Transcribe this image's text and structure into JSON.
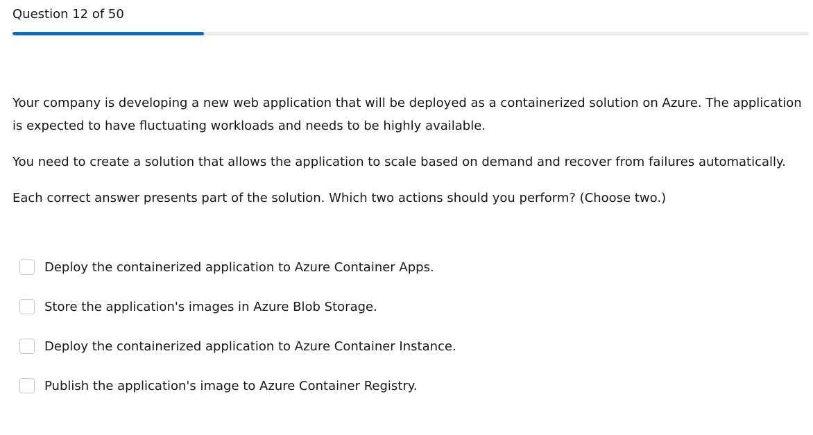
{
  "header": {
    "question_counter": "Question 12 of 50"
  },
  "progress": {
    "current": 12,
    "total": 50,
    "fraction": 0.24,
    "fill_color": "#0f6cbd",
    "track_color": "#ebebeb"
  },
  "question": {
    "paragraphs": [
      "Your company is developing a new web application that will be deployed as a containerized solution on Azure. The application is expected to have fluctuating workloads and needs to be highly available.",
      "You need to create a solution that allows the application to scale based on demand and recover from failures automatically.",
      "Each correct answer presents part of the solution. Which two actions should you perform? (Choose two.)"
    ]
  },
  "options": [
    {
      "label": "Deploy the containerized application to Azure Container Apps.",
      "checked": false
    },
    {
      "label": "Store the application's images in Azure Blob Storage.",
      "checked": false
    },
    {
      "label": "Deploy the containerized application to Azure Container Instance.",
      "checked": false
    },
    {
      "label": "Publish the application's image to Azure Container Registry.",
      "checked": false
    }
  ]
}
